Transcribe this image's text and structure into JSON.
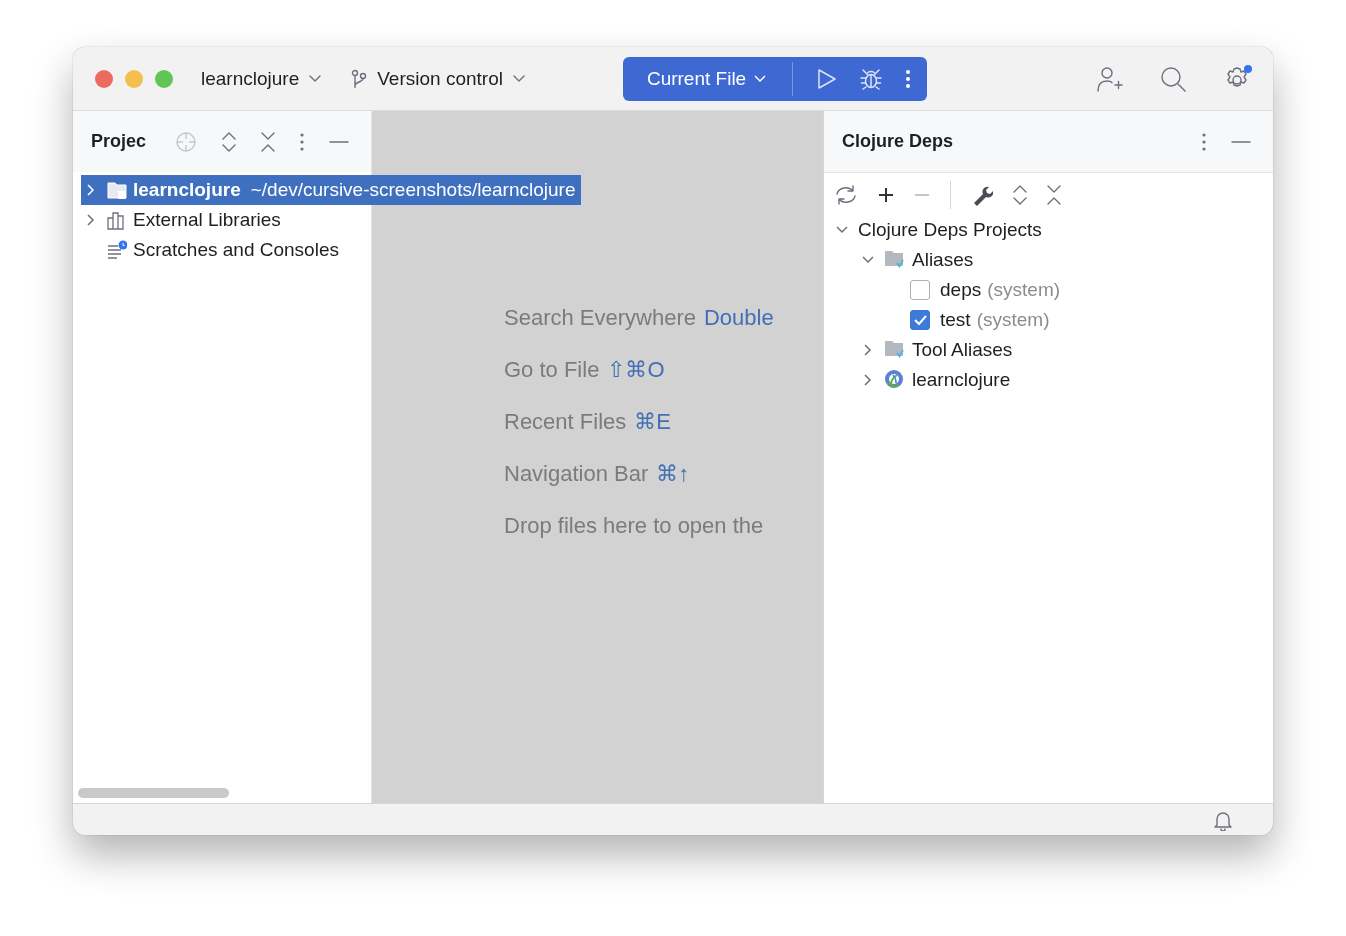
{
  "title_bar": {
    "project": "learnclojure",
    "vcs": "Version control",
    "run_config": "Current File"
  },
  "project_panel": {
    "title": "Projec",
    "tree": [
      {
        "kind": "folder",
        "label": "learnclojure",
        "path": "~/dev/cursive-screenshots/learnclojure",
        "expanded": false,
        "selected": true
      },
      {
        "kind": "library",
        "label": "External Libraries",
        "expanded": false,
        "selected": false
      },
      {
        "kind": "scratch",
        "label": "Scratches and Consoles",
        "selected": false
      }
    ]
  },
  "editor": {
    "hints": [
      {
        "label": "Search Everywhere",
        "shortcut": "Double"
      },
      {
        "label": "Go to File",
        "shortcut": "⇧⌘O"
      },
      {
        "label": "Recent Files",
        "shortcut": "⌘E"
      },
      {
        "label": "Navigation Bar",
        "shortcut": "⌘↑"
      },
      {
        "label": "Drop files here to open the"
      }
    ]
  },
  "deps_panel": {
    "title": "Clojure Deps",
    "tree": [
      {
        "label": "Clojure Deps Projects",
        "expanded": true,
        "children": [
          {
            "kind": "aliases",
            "label": "Aliases",
            "expanded": true,
            "children": [
              {
                "kind": "alias",
                "label": "deps",
                "note": "(system)",
                "checked": false
              },
              {
                "kind": "alias",
                "label": "test",
                "note": "(system)",
                "checked": true
              }
            ]
          },
          {
            "kind": "aliases",
            "label": "Tool Aliases",
            "expanded": false
          },
          {
            "kind": "project",
            "label": "learnclojure",
            "expanded": false
          }
        ]
      }
    ]
  }
}
